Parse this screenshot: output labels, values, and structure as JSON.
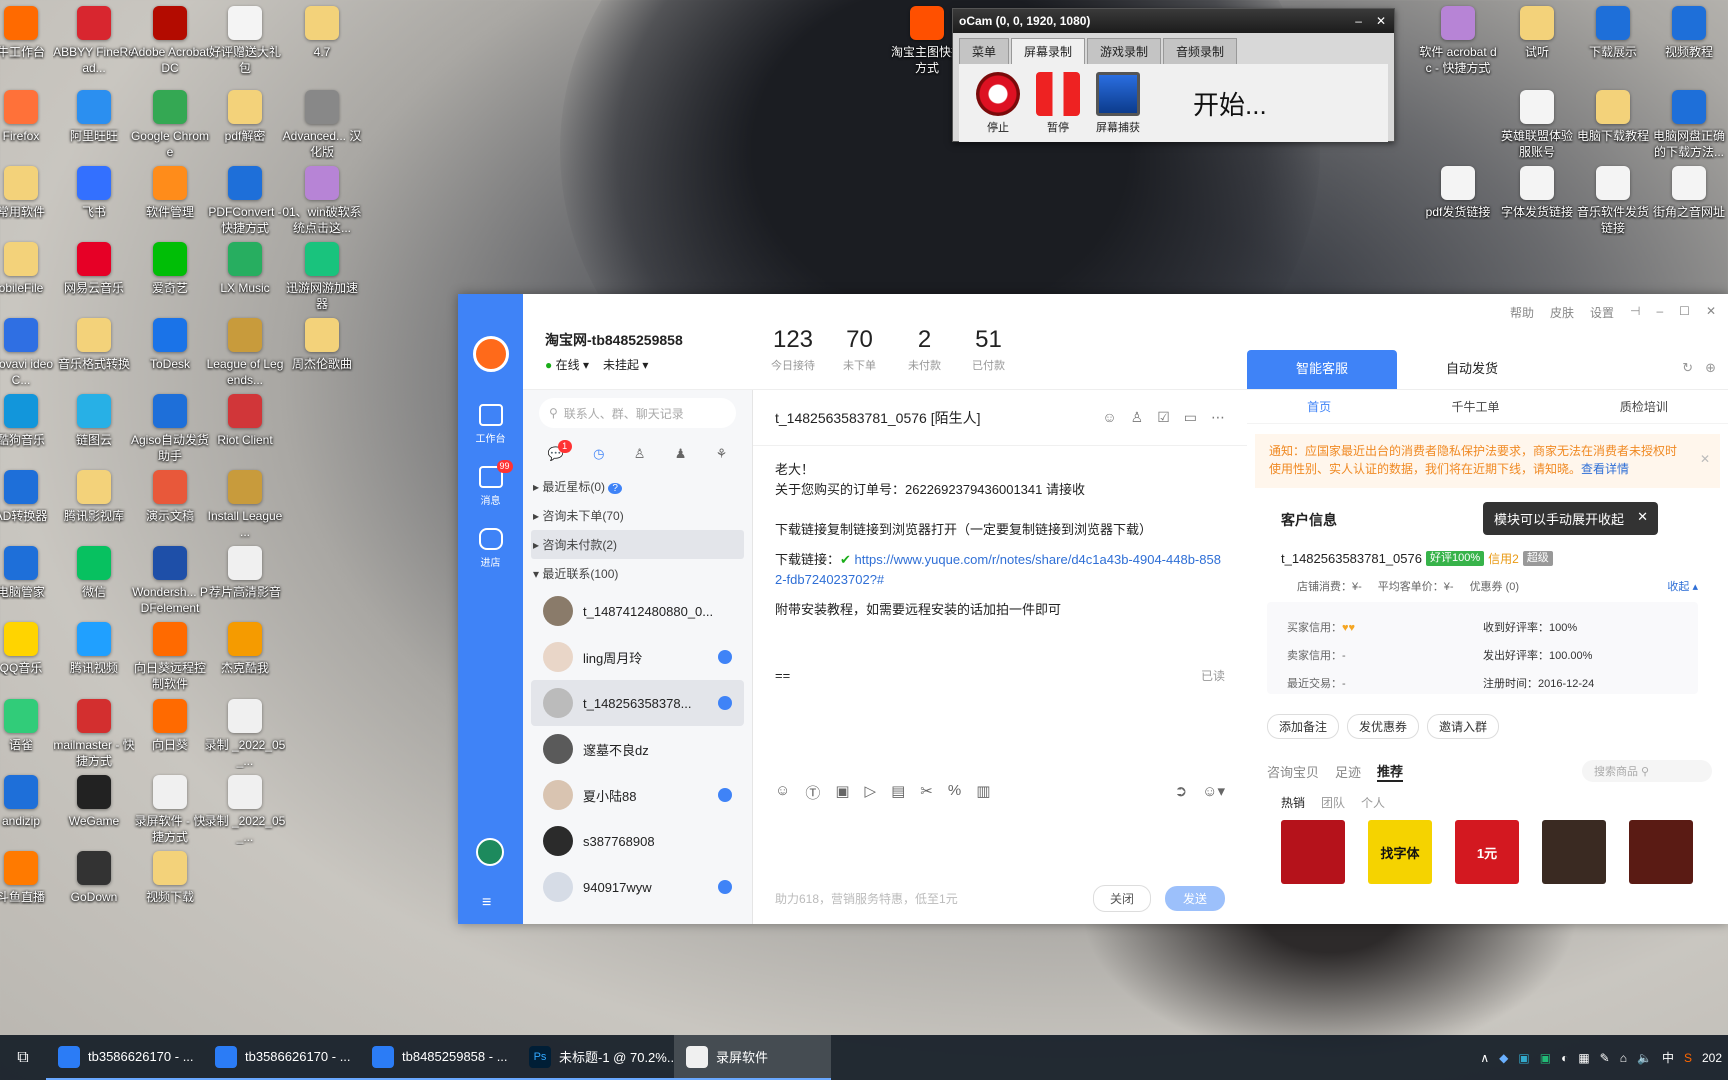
{
  "desktop_icons": [
    {
      "label": "牛工作台",
      "color": "#ff6a00"
    },
    {
      "label": "ABBYY FineRead...",
      "color": "#d8262f"
    },
    {
      "label": "Adobe Acrobat DC",
      "color": "#b30b00"
    },
    {
      "label": "好评赠送大礼包",
      "color": "#f4f4f4"
    },
    {
      "label": "4.7",
      "color": "#f3d27a"
    },
    {
      "label": "Firefox",
      "color": "#ff7139"
    },
    {
      "label": "阿里旺旺",
      "color": "#2b8ff0"
    },
    {
      "label": "Google Chrome",
      "color": "#34a853"
    },
    {
      "label": "pdf解密",
      "color": "#f3d27a"
    },
    {
      "label": "Advanced... 汉化版",
      "color": "#888"
    },
    {
      "label": "常用软件",
      "color": "#f3d27a"
    },
    {
      "label": "飞书",
      "color": "#3370ff"
    },
    {
      "label": "软件管理",
      "color": "#ff8c1a"
    },
    {
      "label": "PDFConvert - 快捷方式",
      "color": "#1e6fd9"
    },
    {
      "label": "01、win破软系统点击这...",
      "color": "#b784d6"
    },
    {
      "label": "obileFile",
      "color": "#f3d27a"
    },
    {
      "label": "网易云音乐",
      "color": "#e60026"
    },
    {
      "label": "爱奇艺",
      "color": "#00be06"
    },
    {
      "label": "LX Music",
      "color": "#27ae60"
    },
    {
      "label": "迅游网游加速器",
      "color": "#19c37d"
    },
    {
      "label": "Movavi ideo C...",
      "color": "#2f6fe3"
    },
    {
      "label": "音乐格式转换",
      "color": "#f3d27a"
    },
    {
      "label": "ToDesk",
      "color": "#1a73e8"
    },
    {
      "label": "League of Legends...",
      "color": "#c89b3c"
    },
    {
      "label": "周杰伦歌曲",
      "color": "#f3d27a"
    },
    {
      "label": "酷狗音乐",
      "color": "#1296db"
    },
    {
      "label": "链图云",
      "color": "#27b0e6"
    },
    {
      "label": "Agiso自动发货助手",
      "color": "#1e6fd9"
    },
    {
      "label": "Riot Client",
      "color": "#d13639"
    },
    {
      "label": "",
      "color": "transparent"
    },
    {
      "label": "AD转换器",
      "color": "#1e6fd9"
    },
    {
      "label": "腾讯影视库",
      "color": "#f3d27a"
    },
    {
      "label": "演示文稿",
      "color": "#e8583a"
    },
    {
      "label": "Install League ...",
      "color": "#c89b3c"
    },
    {
      "label": "",
      "color": "transparent"
    },
    {
      "label": "电脑管家",
      "color": "#1e6fd9"
    },
    {
      "label": "微信",
      "color": "#07c160"
    },
    {
      "label": "Wondersh... PDFelement",
      "color": "#1e4fa8"
    },
    {
      "label": "荐片高清影音",
      "color": "#f0f0f0"
    },
    {
      "label": "",
      "color": "transparent"
    },
    {
      "label": "QQ音乐",
      "color": "#ffd400"
    },
    {
      "label": "腾讯视频",
      "color": "#20a0ff"
    },
    {
      "label": "向日葵远程控制软件",
      "color": "#ff6a00"
    },
    {
      "label": "杰克酷我",
      "color": "#f59b00"
    },
    {
      "label": "",
      "color": "transparent"
    },
    {
      "label": "语雀",
      "color": "#31cc79"
    },
    {
      "label": "mailmaster - 快捷方式",
      "color": "#d32f2f"
    },
    {
      "label": "向日葵",
      "color": "#ff6a00"
    },
    {
      "label": "录制 _2022_05_...",
      "color": "#f0f0f0"
    },
    {
      "label": "",
      "color": "transparent"
    },
    {
      "label": "andizip",
      "color": "#1e6fd9"
    },
    {
      "label": "WeGame",
      "color": "#222"
    },
    {
      "label": "录屏软件 - 快捷方式",
      "color": "#f0f0f0"
    },
    {
      "label": "录制 _2022_05_...",
      "color": "#f0f0f0"
    },
    {
      "label": "",
      "color": "transparent"
    },
    {
      "label": "斗鱼直播",
      "color": "#ff7a00"
    },
    {
      "label": "GoDown",
      "color": "#333"
    },
    {
      "label": "视频下载",
      "color": "#f3d27a"
    }
  ],
  "right_icons": [
    {
      "label": "淘宝主图快捷方式",
      "color": "#ff5000"
    },
    {
      "label": "软件 acrobat dc - 快捷方式",
      "color": "#b784d6"
    },
    {
      "label": "试听",
      "color": "#f3d27a"
    },
    {
      "label": "下载展示",
      "color": "#1e6fd9"
    },
    {
      "label": "视频教程",
      "color": "#1e6fd9"
    },
    {
      "label": "英雄联盟体验服账号",
      "color": "#f4f4f4"
    },
    {
      "label": "电脑下载教程",
      "color": "#f3d27a"
    },
    {
      "label": "电脑网盘正确的下载方法...",
      "color": "#1e6fd9"
    },
    {
      "label": "pdf发货链接",
      "color": "#f4f4f4"
    },
    {
      "label": "字体发货链接",
      "color": "#f4f4f4"
    },
    {
      "label": "音乐软件发货链接",
      "color": "#f4f4f4"
    },
    {
      "label": "街角之音网址",
      "color": "#f4f4f4"
    }
  ],
  "ocam": {
    "title": "oCam (0, 0, 1920, 1080)",
    "tabs": [
      "菜单",
      "屏幕录制",
      "游戏录制",
      "音频录制"
    ],
    "stop": "停止",
    "pause": "暂停",
    "capture": "屏幕捕获",
    "status": "开始..."
  },
  "qn": {
    "account": "淘宝网-tb8485259858",
    "online": "在线",
    "hang": "未挂起",
    "stats": [
      {
        "v": "123",
        "l": "今日接待"
      },
      {
        "v": "70",
        "l": "未下单"
      },
      {
        "v": "2",
        "l": "未付款"
      },
      {
        "v": "51",
        "l": "已付款"
      }
    ],
    "nav": {
      "workbench": "工作台",
      "messages": "消息",
      "messages_badge": "99",
      "shop": "进店"
    },
    "search_placeholder": "联系人、群、聊天记录",
    "chat_badge": "1",
    "groups": [
      "最近星标(0)",
      "咨询未下单(70)",
      "咨询未付款(2)",
      "最近联系(100)"
    ],
    "contacts": [
      "t_1487412480880_0...",
      "ling周月玲",
      "t_148256358378...",
      "邃墓不良dz",
      "夏小陆88",
      "s387768908",
      "940917wyw"
    ],
    "chat_title": "t_1482563583781_0576 [陌生人]",
    "msg_lines": [
      "老大！",
      "关于您购买的订单号：2622692379436001341 请接收",
      "",
      "下载链接复制链接到浏览器打开（一定要复制链接到浏览器下载）"
    ],
    "link_label": "下载链接：",
    "link": "https://www.yuque.com/r/notes/share/d4c1a43b-4904-448b-8582-fdb724023702?#",
    "msg_tail": "附带安装教程，如需要远程安装的话加拍一件即可",
    "input_text": "==",
    "read": "已读",
    "footer_hint": "助力618，营销服务特惠，低至1元",
    "close": "关闭",
    "send": "发送",
    "top_links": [
      "帮助",
      "皮肤",
      "设置"
    ],
    "rtabs": [
      "智能客服",
      "自动发货"
    ],
    "subtabs": [
      "首页",
      "千牛工单",
      "质检培训"
    ],
    "notice": "通知：应国家最近出台的消费者隐私保护法要求，商家无法在消费者未授权时使用性别、实人认证的数据，我们将在近期下线，请知晓。",
    "notice_link": "查看详情",
    "customer_info": "客户信息",
    "tooltip": "模块可以手动展开收起",
    "customer": "t_1482563583781_0576",
    "good_rate_tag": "好评100%",
    "credit": "信用2",
    "vip_tag": "超级",
    "spend": "店铺消费：¥-",
    "avg": "平均客单价：¥-",
    "coupon": "优惠券 (0)",
    "collapse": "收起",
    "buyer_credit": "买家信用：",
    "seller_credit": "卖家信用：-",
    "recent": "最近交易：-",
    "recv_rate": "收到好评率：100%",
    "send_rate": "发出好评率：100.00%",
    "reg": "注册时间：2016-12-24",
    "actions": [
      "添加备注",
      "发优惠券",
      "邀请入群"
    ],
    "prod_tabs": [
      "咨询宝贝",
      "足迹",
      "推荐"
    ],
    "prod_search": "搜索商品",
    "hot_tabs": [
      "热销",
      "团队",
      "个人"
    ],
    "products": [
      {
        "color": "#b5121b",
        "text": ""
      },
      {
        "color": "#f5d300",
        "text": "找字体"
      },
      {
        "color": "#d31820",
        "text": "1元"
      },
      {
        "color": "#3a2a22",
        "text": ""
      },
      {
        "color": "#5a1b14",
        "text": ""
      }
    ]
  },
  "taskbar": {
    "items": [
      "tb3586626170 - ...",
      "tb3586626170 - ...",
      "tb8485259858 - ...",
      "未标题-1 @ 70.2%...",
      "录屏软件"
    ],
    "ime": "中",
    "clock": "202"
  }
}
